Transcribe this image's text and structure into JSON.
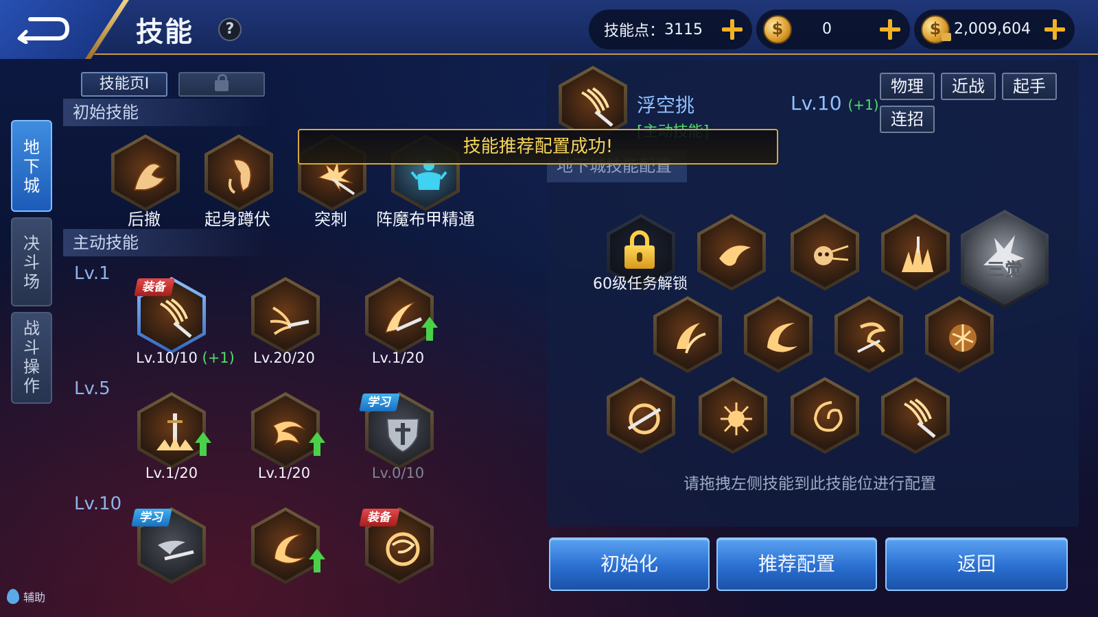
{
  "header": {
    "title": "技能",
    "help": "?",
    "skill_points_label": "技能点：",
    "skill_points": "3115",
    "coin_a": "0",
    "coin_b": "2,009,604"
  },
  "side_tabs": [
    {
      "label": [
        "地",
        "下",
        "城"
      ]
    },
    {
      "label": [
        "决",
        "斗",
        "场"
      ]
    },
    {
      "label": [
        "战",
        "斗",
        "操",
        "作"
      ]
    }
  ],
  "assist_label": "辅助",
  "page_tabs": {
    "page1": "技能页Ⅰ"
  },
  "sections": {
    "initial": "初始技能",
    "active": "主动技能"
  },
  "initial_skills": [
    {
      "name": "后撤"
    },
    {
      "name": "起身蹲伏"
    },
    {
      "name": "突刺"
    },
    {
      "name": "阵魔布甲精通"
    }
  ],
  "tiers": [
    "Lv.1",
    "Lv.5",
    "Lv.10"
  ],
  "active_skills": [
    {
      "level": "Lv.10/10",
      "bonus": "(+1)",
      "badge": "装备"
    },
    {
      "level": "Lv.20/20"
    },
    {
      "level": "Lv.1/20"
    },
    {
      "level": "Lv.1/20"
    },
    {
      "level": "Lv.1/20"
    },
    {
      "level": "Lv.0/10",
      "badge": "学习"
    },
    {
      "badge": "学习"
    },
    {},
    {
      "badge": "装备"
    }
  ],
  "detail": {
    "name": "浮空挑",
    "type": "[主动技能]",
    "level": "Lv.10",
    "bonus": "(+1)",
    "tags": [
      "物理",
      "近战",
      "起手",
      "连招"
    ]
  },
  "config_header": "地下城技能配置",
  "toast": "技能推荐配置成功!",
  "unlock_text": "60级任务解锁",
  "awaken_label": "三觉",
  "hint": "请拖拽左侧技能到此技能位进行配置",
  "buttons": {
    "reset": "初始化",
    "recommend": "推荐配置",
    "back": "返回"
  },
  "colors": {
    "accent_gold": "#d8a936",
    "bonus_green": "#4fe06a",
    "active_tab_blue": "#1d5bb8"
  }
}
